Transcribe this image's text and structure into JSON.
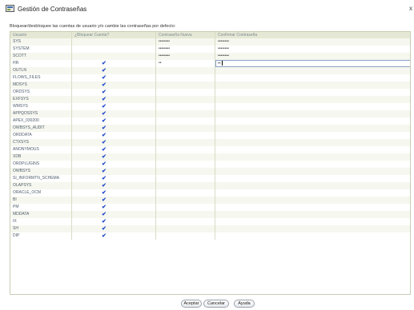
{
  "window": {
    "title": "Gestión de Contraseñas",
    "close_label": "x"
  },
  "instruction": "Bloquear/desbloquee las cuentas de usuario y/o cambie las contraseñas por defecto:",
  "columns": [
    "Usuario",
    "¿Bloquear Cuenta?",
    "Contraseña Nueva",
    "Confirmar Contraseña"
  ],
  "rows": [
    {
      "user": "SYS",
      "locked": false,
      "new_pwd": "••••••••",
      "confirm_pwd": "••••••••"
    },
    {
      "user": "SYSTEM",
      "locked": false,
      "new_pwd": "••••••••",
      "confirm_pwd": "••••••••"
    },
    {
      "user": "SCOTT",
      "locked": false,
      "new_pwd": "••••••••",
      "confirm_pwd": "••••••••"
    },
    {
      "user": "HR",
      "locked": true,
      "new_pwd": "••",
      "confirm_pwd": "••"
    },
    {
      "user": "OUTLN",
      "locked": true,
      "new_pwd": "",
      "confirm_pwd": ""
    },
    {
      "user": "FLOWS_FILES",
      "locked": true,
      "new_pwd": "",
      "confirm_pwd": ""
    },
    {
      "user": "MDSYS",
      "locked": true,
      "new_pwd": "",
      "confirm_pwd": ""
    },
    {
      "user": "ORDSYS",
      "locked": true,
      "new_pwd": "",
      "confirm_pwd": ""
    },
    {
      "user": "EXFSYS",
      "locked": true,
      "new_pwd": "",
      "confirm_pwd": ""
    },
    {
      "user": "WMSYS",
      "locked": true,
      "new_pwd": "",
      "confirm_pwd": ""
    },
    {
      "user": "APPQOSSYS",
      "locked": true,
      "new_pwd": "",
      "confirm_pwd": ""
    },
    {
      "user": "APEX_030200",
      "locked": true,
      "new_pwd": "",
      "confirm_pwd": ""
    },
    {
      "user": "OWBSYS_AUDIT",
      "locked": true,
      "new_pwd": "",
      "confirm_pwd": ""
    },
    {
      "user": "ORDDATA",
      "locked": true,
      "new_pwd": "",
      "confirm_pwd": ""
    },
    {
      "user": "CTXSYS",
      "locked": true,
      "new_pwd": "",
      "confirm_pwd": ""
    },
    {
      "user": "ANONYMOUS",
      "locked": true,
      "new_pwd": "",
      "confirm_pwd": ""
    },
    {
      "user": "XDB",
      "locked": true,
      "new_pwd": "",
      "confirm_pwd": ""
    },
    {
      "user": "ORDPLUGINS",
      "locked": true,
      "new_pwd": "",
      "confirm_pwd": ""
    },
    {
      "user": "OWBSYS",
      "locked": true,
      "new_pwd": "",
      "confirm_pwd": ""
    },
    {
      "user": "SI_INFORMTN_SCHEMA",
      "locked": true,
      "new_pwd": "",
      "confirm_pwd": ""
    },
    {
      "user": "OLAPSYS",
      "locked": true,
      "new_pwd": "",
      "confirm_pwd": ""
    },
    {
      "user": "ORACLE_OCM",
      "locked": true,
      "new_pwd": "",
      "confirm_pwd": ""
    },
    {
      "user": "BI",
      "locked": true,
      "new_pwd": "",
      "confirm_pwd": ""
    },
    {
      "user": "PM",
      "locked": true,
      "new_pwd": "",
      "confirm_pwd": ""
    },
    {
      "user": "MDDATA",
      "locked": true,
      "new_pwd": "",
      "confirm_pwd": ""
    },
    {
      "user": "IX",
      "locked": true,
      "new_pwd": "",
      "confirm_pwd": ""
    },
    {
      "user": "SH",
      "locked": true,
      "new_pwd": "",
      "confirm_pwd": ""
    },
    {
      "user": "DIP",
      "locked": true,
      "new_pwd": "",
      "confirm_pwd": ""
    }
  ],
  "buttons": {
    "ok": "Aceptar",
    "cancel": "Cancelar",
    "help": "Ayuda"
  },
  "colors": {
    "header_bg": "#e5e8d4",
    "check": "#1f47c9",
    "grid_border": "#c9cdb4"
  }
}
